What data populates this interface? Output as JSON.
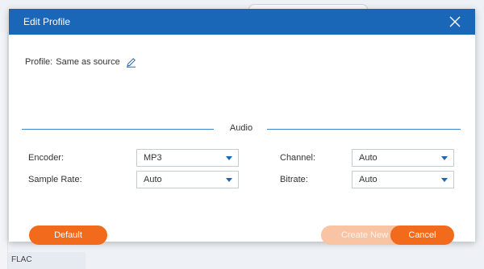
{
  "background": {
    "list_item_fragment": "FLAC"
  },
  "dialog": {
    "title": "Edit Profile",
    "profile": {
      "label": "Profile:",
      "value": "Same as source"
    },
    "section_title": "Audio",
    "fields": {
      "encoder": {
        "label": "Encoder:",
        "value": "MP3"
      },
      "sample_rate": {
        "label": "Sample Rate:",
        "value": "Auto"
      },
      "channel": {
        "label": "Channel:",
        "value": "Auto"
      },
      "bitrate": {
        "label": "Bitrate:",
        "value": "Auto"
      }
    },
    "buttons": {
      "default": "Default",
      "create_new": "Create New",
      "cancel": "Cancel"
    }
  },
  "colors": {
    "titlebar": "#1a67b8",
    "accent_orange": "#f26a1b",
    "disabled_orange": "#f9c4a4",
    "divider_blue": "#3a86d1"
  },
  "icons": {
    "close": "close-icon",
    "edit": "pencil-icon",
    "dropdown": "chevron-down-icon"
  }
}
